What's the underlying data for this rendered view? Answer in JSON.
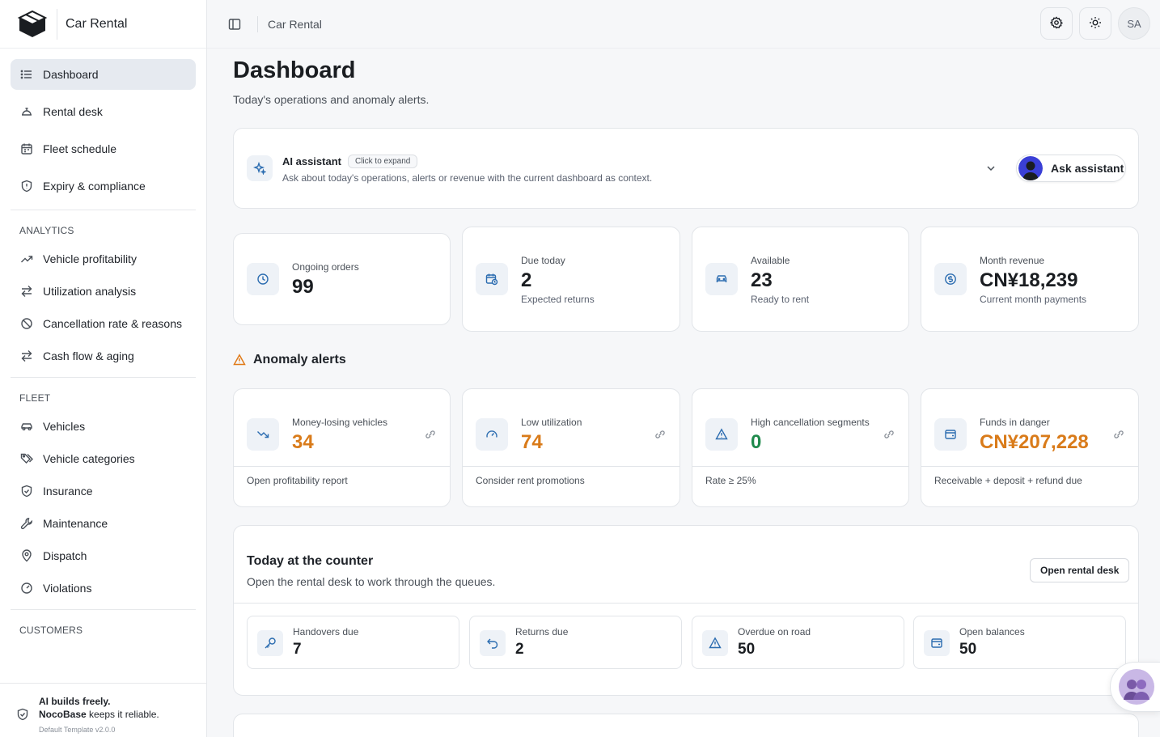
{
  "brand": {
    "name": "Car Rental"
  },
  "header": {
    "title": "Car Rental",
    "avatar_initials": "SA"
  },
  "sidebar": {
    "primary": [
      {
        "label": "Dashboard"
      },
      {
        "label": "Rental desk"
      },
      {
        "label": "Fleet schedule"
      },
      {
        "label": "Expiry & compliance"
      }
    ],
    "analytics_heading": "ANALYTICS",
    "analytics": [
      {
        "label": "Vehicle profitability"
      },
      {
        "label": "Utilization analysis"
      },
      {
        "label": "Cancellation rate & reasons"
      },
      {
        "label": "Cash flow & aging"
      }
    ],
    "fleet_heading": "FLEET",
    "fleet": [
      {
        "label": "Vehicles"
      },
      {
        "label": "Vehicle categories"
      },
      {
        "label": "Insurance"
      },
      {
        "label": "Maintenance"
      },
      {
        "label": "Dispatch"
      },
      {
        "label": "Violations"
      }
    ],
    "customers_heading": "CUSTOMERS",
    "footer": {
      "line1": "AI builds freely.",
      "brand": "NocoBase",
      "line2_rest": " keeps it reliable.",
      "version": "Default Template v2.0.0"
    }
  },
  "page": {
    "title": "Dashboard",
    "subtitle": "Today's operations and anomaly alerts."
  },
  "ai": {
    "title": "AI assistant",
    "badge": "Click to expand",
    "description": "Ask about today's operations, alerts or revenue with the current dashboard as context.",
    "button": "Ask assistant"
  },
  "stats": [
    {
      "label": "Ongoing orders",
      "value": "99",
      "foot": ""
    },
    {
      "label": "Due today",
      "value": "2",
      "foot": "Expected returns"
    },
    {
      "label": "Available",
      "value": "23",
      "foot": "Ready to rent"
    },
    {
      "label": "Month revenue",
      "value": "CN¥18,239",
      "foot": "Current month payments"
    }
  ],
  "alerts_heading": "Anomaly alerts",
  "alerts": [
    {
      "label": "Money-losing vehicles",
      "value": "34",
      "foot": "Open profitability report"
    },
    {
      "label": "Low utilization",
      "value": "74",
      "foot": "Consider rent promotions"
    },
    {
      "label": "High cancellation segments",
      "value": "0",
      "foot": "Rate ≥ 25%"
    },
    {
      "label": "Funds in danger",
      "value": "CN¥207,228",
      "foot": "Receivable + deposit + refund due"
    }
  ],
  "counter": {
    "title": "Today at the counter",
    "subtitle": "Open the rental desk to work through the queues.",
    "button": "Open rental desk",
    "items": [
      {
        "label": "Handovers due",
        "value": "7"
      },
      {
        "label": "Returns due",
        "value": "2"
      },
      {
        "label": "Overdue on road",
        "value": "50"
      },
      {
        "label": "Open balances",
        "value": "50"
      }
    ]
  },
  "colors": {
    "accent": "#2b6cb0",
    "warning": "#d97b1a",
    "success": "#1f8a4c",
    "active_nav": "#e6eaf0"
  }
}
